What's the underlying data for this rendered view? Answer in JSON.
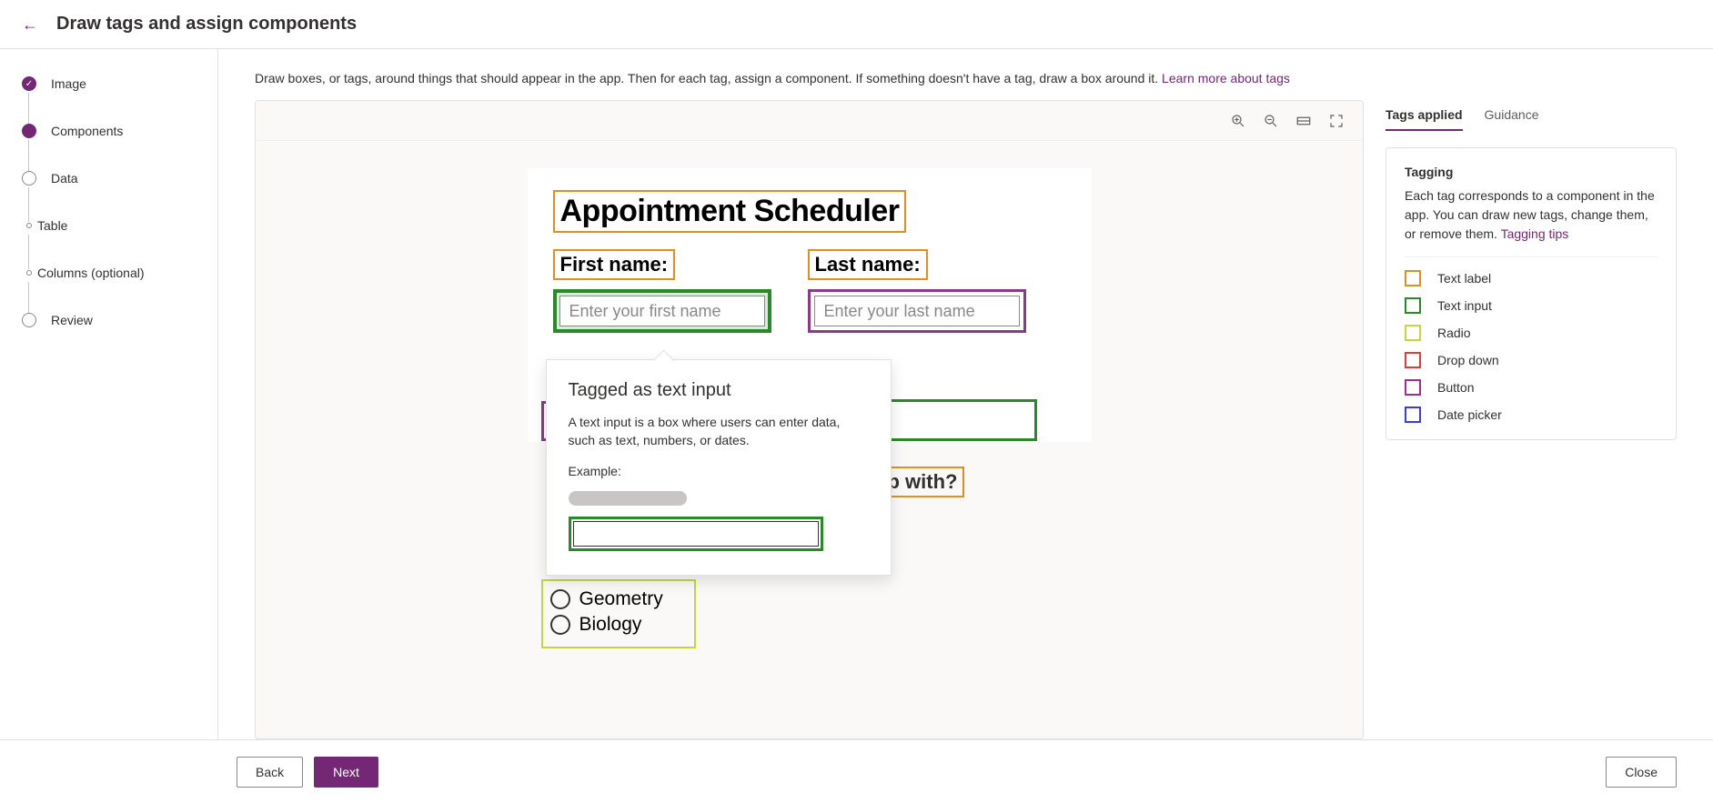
{
  "header": {
    "title": "Draw tags and assign components"
  },
  "steps": [
    {
      "label": "Image",
      "state": "done"
    },
    {
      "label": "Components",
      "state": "active"
    },
    {
      "label": "Data",
      "state": "pending"
    },
    {
      "label": "Table",
      "state": "sub"
    },
    {
      "label": "Columns (optional)",
      "state": "sub"
    },
    {
      "label": "Review",
      "state": "pending"
    }
  ],
  "instructions": {
    "text": "Draw boxes, or tags, around things that should appear in the app. Then for each tag, assign a component. If something doesn't have a tag, draw a box around it. ",
    "link": "Learn more about tags"
  },
  "canvas": {
    "title": "Appointment Scheduler",
    "fields": [
      {
        "label": "First name:",
        "placeholder": "Enter your first name",
        "selected": true,
        "style": "green"
      },
      {
        "label": "Last name:",
        "placeholder": "Enter your last name",
        "selected": false,
        "style": "purple"
      }
    ],
    "peek_label": "p with?",
    "radios": [
      "Geometry",
      "Biology"
    ]
  },
  "tooltip": {
    "title": "Tagged as text input",
    "desc": "A text input is a box where users can enter data, such as text, numbers, or dates.",
    "example_label": "Example:"
  },
  "right_panel": {
    "tabs": [
      "Tags applied",
      "Guidance"
    ],
    "active_tab": 0,
    "tagging_title": "Tagging",
    "tagging_desc": "Each tag corresponds to a component in the app. You can draw new tags, change them, or remove them. ",
    "tagging_link": "Tagging tips",
    "legend": [
      {
        "label": "Text label",
        "color": "#e18f1f"
      },
      {
        "label": "Text input",
        "color": "#2a8a2a"
      },
      {
        "label": "Radio",
        "color": "#c5d63e"
      },
      {
        "label": "Drop down",
        "color": "#e23b3b"
      },
      {
        "label": "Button",
        "color": "#a22aa2"
      },
      {
        "label": "Date picker",
        "color": "#3b3be2"
      }
    ]
  },
  "footer": {
    "back": "Back",
    "next": "Next",
    "close": "Close"
  }
}
